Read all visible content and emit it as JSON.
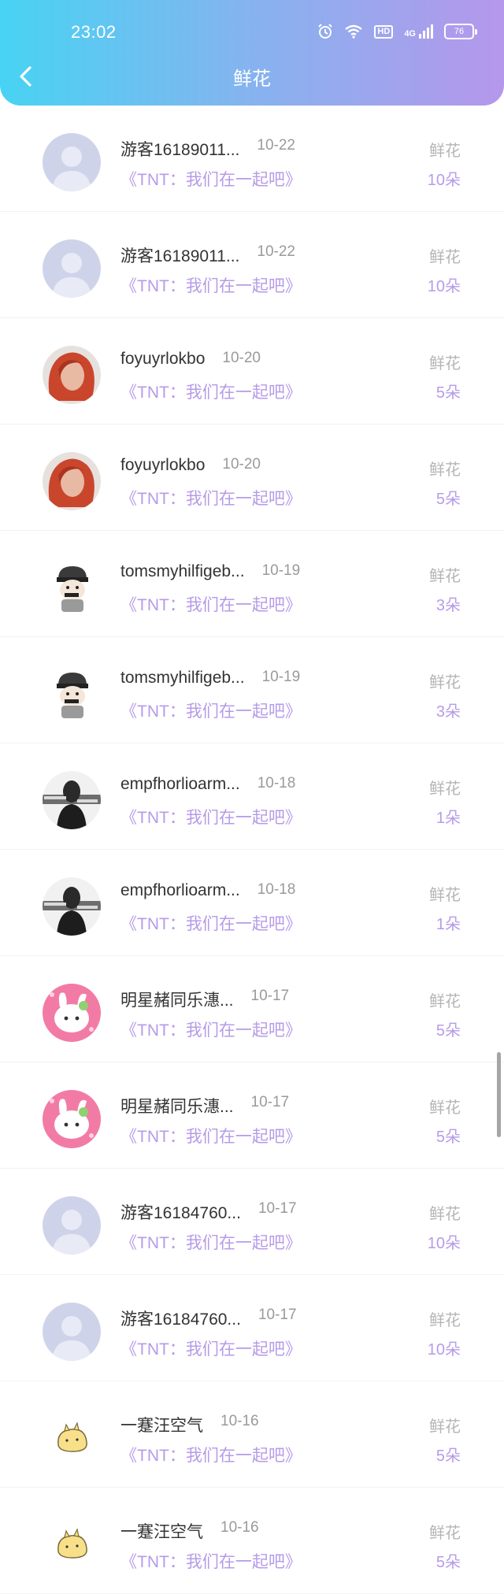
{
  "status_bar": {
    "time": "23:02",
    "network": "4G",
    "battery": "76",
    "hd": "HD"
  },
  "header": {
    "title": "鲜花"
  },
  "list": [
    {
      "name": "游客16189011...",
      "date": "10-22",
      "subtitle": "《TNT：我们在一起吧》",
      "kind": "鲜花",
      "count": "10朵",
      "avatar": "default-avatar"
    },
    {
      "name": "游客16189011...",
      "date": "10-22",
      "subtitle": "《TNT：我们在一起吧》",
      "kind": "鲜花",
      "count": "10朵",
      "avatar": "default-avatar"
    },
    {
      "name": "foyuyrlokbo",
      "date": "10-20",
      "subtitle": "《TNT：我们在一起吧》",
      "kind": "鲜花",
      "count": "5朵",
      "avatar": "red-hair-avatar"
    },
    {
      "name": "foyuyrlokbo",
      "date": "10-20",
      "subtitle": "《TNT：我们在一起吧》",
      "kind": "鲜花",
      "count": "5朵",
      "avatar": "red-hair-avatar"
    },
    {
      "name": "tomsmyhilfigeb...",
      "date": "10-19",
      "subtitle": "《TNT：我们在一起吧》",
      "kind": "鲜花",
      "count": "3朵",
      "avatar": "cartoon-boy-avatar"
    },
    {
      "name": "tomsmyhilfigeb...",
      "date": "10-19",
      "subtitle": "《TNT：我们在一起吧》",
      "kind": "鲜花",
      "count": "3朵",
      "avatar": "cartoon-boy-avatar"
    },
    {
      "name": "empfhorlioarm...",
      "date": "10-18",
      "subtitle": "《TNT：我们在一起吧》",
      "kind": "鲜花",
      "count": "1朵",
      "avatar": "dark-photo-avatar"
    },
    {
      "name": "empfhorlioarm...",
      "date": "10-18",
      "subtitle": "《TNT：我们在一起吧》",
      "kind": "鲜花",
      "count": "1朵",
      "avatar": "dark-photo-avatar"
    },
    {
      "name": "明星赭同乐潓...",
      "date": "10-17",
      "subtitle": "《TNT：我们在一起吧》",
      "kind": "鲜花",
      "count": "5朵",
      "avatar": "pink-bunny-avatar"
    },
    {
      "name": "明星赭同乐潓...",
      "date": "10-17",
      "subtitle": "《TNT：我们在一起吧》",
      "kind": "鲜花",
      "count": "5朵",
      "avatar": "pink-bunny-avatar"
    },
    {
      "name": "游客16184760...",
      "date": "10-17",
      "subtitle": "《TNT：我们在一起吧》",
      "kind": "鲜花",
      "count": "10朵",
      "avatar": "default-avatar"
    },
    {
      "name": "游客16184760...",
      "date": "10-17",
      "subtitle": "《TNT：我们在一起吧》",
      "kind": "鲜花",
      "count": "10朵",
      "avatar": "default-avatar"
    },
    {
      "name": "一蹇汪空气",
      "date": "10-16",
      "subtitle": "《TNT：我们在一起吧》",
      "kind": "鲜花",
      "count": "5朵",
      "avatar": "yellow-chick-avatar"
    },
    {
      "name": "一蹇汪空气",
      "date": "10-16",
      "subtitle": "《TNT：我们在一起吧》",
      "kind": "鲜花",
      "count": "5朵",
      "avatar": "yellow-chick-avatar"
    }
  ]
}
